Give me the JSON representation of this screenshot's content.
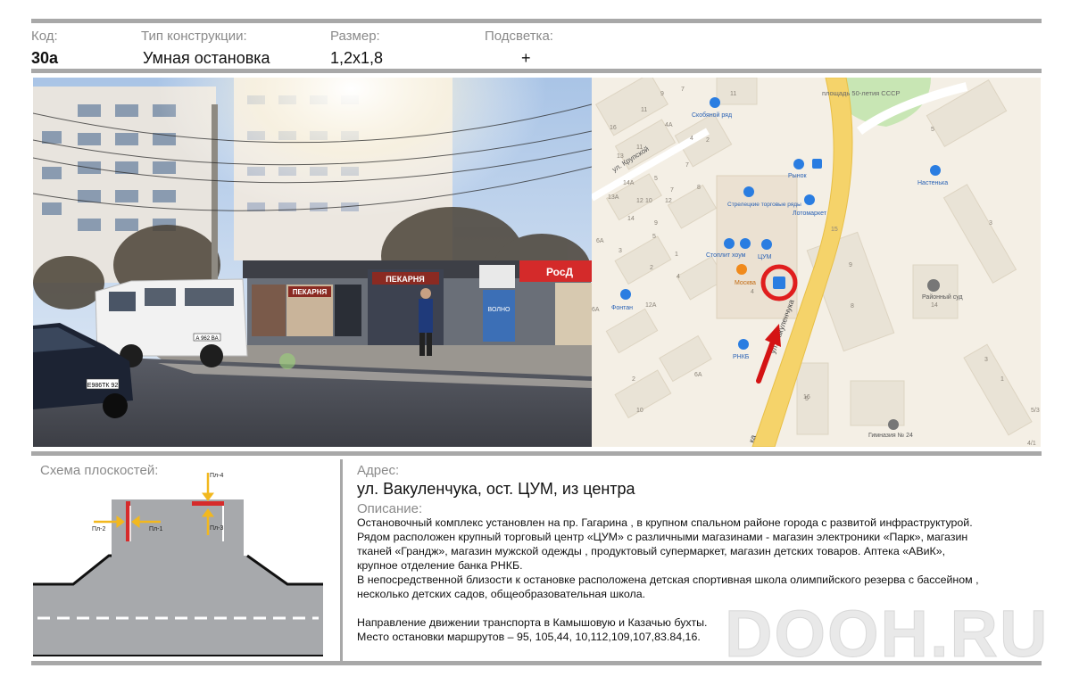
{
  "header": {
    "code_label": "Код:",
    "code_value": "30а",
    "type_label": "Тип конструкции:",
    "type_value": "Умная остановка",
    "size_label": "Размер:",
    "size_value": "1,2х1,8",
    "light_label": "Подсветка:",
    "light_value": "+"
  },
  "photo": {
    "signs": [
      "ПЕКАРНЯ",
      "ПЕКАРНЯ",
      "РосД",
      "мобильн телефон сайны",
      "ВОЛНО"
    ],
    "car_plate": "Е986ТК 92",
    "van_plate": "А 962 ВА"
  },
  "map": {
    "labels": {
      "skobyanoy": "Скобяной ряд",
      "square": "площадь 50-летия СССР",
      "krupskoy": "ул. Крупской",
      "rynok": "Рынок",
      "nastenka": "Настенька",
      "streletskie": "Стрелецкие торговые ряды",
      "lotomarket": "Лотомаркет",
      "stroyplit": "Стоплит хоум",
      "tsum": "ЦУМ",
      "moskva": "Москва",
      "fontan": "Фонтан",
      "rnkb": "РНКБ",
      "vakulenchuka": "ул. Вакуленчука",
      "ka": "ка",
      "court": "Районный суд",
      "gymnasium": "Гимназия № 24"
    },
    "numbers": [
      "11",
      "9",
      "7",
      "4А",
      "11",
      "4",
      "2",
      "16",
      "13",
      "11",
      "7",
      "14А",
      "5",
      "12",
      "13А",
      "10",
      "12",
      "9",
      "14",
      "8",
      "7",
      "6А",
      "5",
      "15",
      "1",
      "3",
      "4",
      "2",
      "6А",
      "4",
      "12А",
      "6А",
      "2",
      "10",
      "5",
      "9",
      "3",
      "5/3",
      "4/1",
      "1",
      "16",
      "14",
      "8",
      "3",
      "5"
    ],
    "colors": {
      "road": "#f5d36a",
      "marker": "#e01e1e",
      "arrow": "#d41414",
      "poi_blue": "#2a7de1",
      "poi_orange": "#f08a1c"
    }
  },
  "scheme": {
    "title": "Схема плоскостей:",
    "planes": [
      "Пл-1",
      "Пл-2",
      "Пл-3",
      "Пл-4"
    ]
  },
  "address": {
    "label": "Адрес:",
    "value": "ул. Вакуленчука, ост. ЦУМ, из центра"
  },
  "description": {
    "label": "Описание:",
    "lines": [
      "Остановочный комплекс установлен на пр. Гагарина , в крупном спальном районе города  с развитой инфраструктурой.",
      "Рядом расположен  крупный торговый центр «ЦУМ» с различными магазинами -  магазин электроники «Парк», магазин",
      "тканей «Грандж», магазин мужской одежды , продуктовый супермаркет, магазин детских товаров. Аптека «АВиК»,",
      "крупное отделение банка РНКБ.",
      "В непосредственной близости к остановке расположена детская спортивная школа  олимпийского резерва с бассейном ,",
      "несколько детских садов, общеобразовательная школа.",
      "",
      "Направление движении транспорта в Камышовую и Казачью бухты.",
      "Место остановки маршрутов – 95, 105,44, 10,112,109,107,83.84,16."
    ]
  },
  "watermark": "DOOH.RU"
}
